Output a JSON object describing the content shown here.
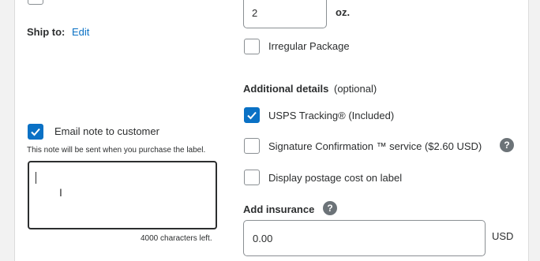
{
  "ship_to": {
    "label": "Ship to:",
    "edit_link": "Edit"
  },
  "email_note": {
    "checkbox_label": "Email note to customer",
    "checked": true,
    "description": "This note will be sent when you purchase the label.",
    "textarea_value": "",
    "chars_left": "4000 characters left."
  },
  "weight": {
    "value": "2",
    "unit": "oz."
  },
  "irregular_package": {
    "label": "Irregular Package",
    "checked": false
  },
  "additional_details": {
    "title": "Additional details",
    "optional": "(optional)",
    "options": [
      {
        "label": "USPS Tracking® (Included)",
        "checked": true
      },
      {
        "label": "Signature Confirmation ™ service ($2.60 USD)",
        "checked": false,
        "help": "?"
      },
      {
        "label": "Display postage cost on label",
        "checked": false
      }
    ]
  },
  "insurance": {
    "title": "Add insurance",
    "help": "?",
    "value": "0.00",
    "currency": "USD"
  },
  "colors": {
    "accent": "#0a71c5",
    "border": "#8a8f93",
    "help_icon": "#6c7378"
  }
}
